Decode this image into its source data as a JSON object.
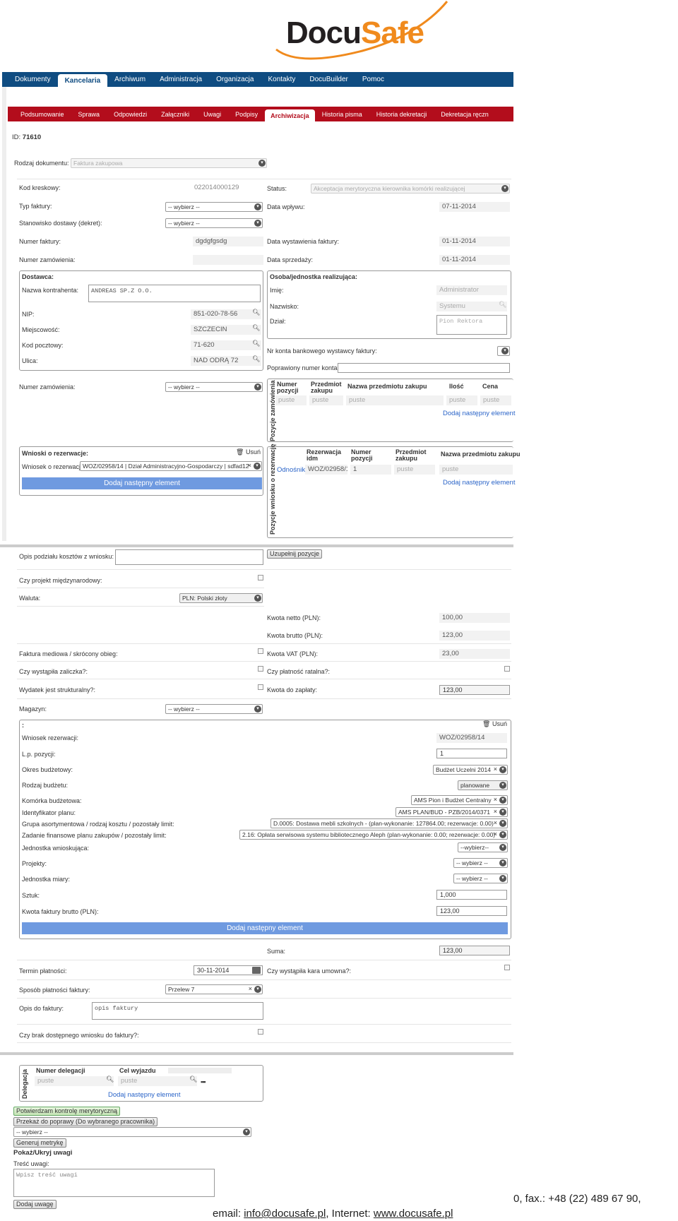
{
  "logo": {
    "part1": "Docu",
    "part2": "Safe"
  },
  "topnav": [
    "Dokumenty",
    "Kancelaria",
    "Archiwum",
    "Administracja",
    "Organizacja",
    "Kontakty",
    "DocuBuilder",
    "Pomoc"
  ],
  "subnav": [
    "Podsumowanie",
    "Sprawa",
    "Odpowiedzi",
    "Załączniki",
    "Uwagi",
    "Podpisy",
    "Archiwizacja",
    "Historia pisma",
    "Historia dekretacji",
    "Dekretacja ręczn"
  ],
  "id_label": "ID:",
  "id_value": "71610",
  "doc_type": {
    "label": "Rodzaj dokumentu:",
    "value": "Faktura zakupowa"
  },
  "left": {
    "barcode": {
      "label": "Kod kreskowy:",
      "value": "022014000129"
    },
    "invoice_type": {
      "label": "Typ faktury:",
      "value": "-- wybierz --"
    },
    "delivery_post": {
      "label": "Stanowisko dostawy (dekret):",
      "value": "-- wybierz --"
    },
    "invoice_number": {
      "label": "Numer faktury:",
      "value": "dgdgfgsdg"
    },
    "order_number": {
      "label": "Numer zamówienia:",
      "value": ""
    }
  },
  "right": {
    "status": {
      "label": "Status:",
      "value": "Akceptacja merytoryczna kierownika komórki realizującej"
    },
    "receipt_date": {
      "label": "Data wpływu:",
      "value": "07-11-2014"
    },
    "issue_date": {
      "label": "Data wystawienia faktury:",
      "value": "01-11-2014"
    },
    "sale_date": {
      "label": "Data sprzedaży:",
      "value": "01-11-2014"
    }
  },
  "supplier": {
    "title": "Dostawca:",
    "name_label": "Nazwa kontrahenta:",
    "name": "ANDREAS SP.Z O.O.",
    "nip_label": "NIP:",
    "nip": "851-020-78-56",
    "city_label": "Miejscowość:",
    "city": "SZCZECIN",
    "zip_label": "Kod pocztowy:",
    "zip": "71-620",
    "street_label": "Ulica:",
    "street": "NAD ODRĄ 72"
  },
  "person": {
    "title": "Osoba/jednostka realizująca:",
    "first_label": "Imię:",
    "first": "Administrator",
    "last_label": "Nazwisko:",
    "last": "Systemu",
    "dept_label": "Dział:",
    "dept": "Pion Rektora"
  },
  "bank": {
    "label": "Nr konta bankowego wystawcy faktury:",
    "fixed_label": "Poprawiony numer konta:"
  },
  "order_select": {
    "label": "Numer zamówienia:",
    "value": "-- wybierz --"
  },
  "order_items": {
    "vlabel": "Pozycje zamówienia",
    "cols": [
      "Numer pozycji",
      "Przedmiot zakupu",
      "Nazwa przedmiotu zakupu",
      "Ilość",
      "Cena"
    ],
    "placeholders": [
      "puste",
      "puste",
      "puste",
      "puste",
      "puste"
    ],
    "add": "Dodaj następny element"
  },
  "reservations": {
    "title": "Wnioski o rezerwacje:",
    "remove": "Usuń",
    "row_label": "Wniosek o rezerwację",
    "row_value": "WOZ/02958/14 | Dział Administracyjno-Gospodarczy | sdfad12",
    "add": "Dodaj następny element"
  },
  "res_items": {
    "vlabel": "Pozycje wniosku o rezerwację",
    "cols": [
      "Rezerwacja idm",
      "Numer pozycji",
      "Przedmiot zakupu",
      "Nazwa przedmiotu zakupu"
    ],
    "link": "Odnośnik",
    "idm": "WOZ/02958/1",
    "pos": "1",
    "ph1": "puste",
    "ph2": "puste",
    "add": "Dodaj następny element"
  },
  "cost_desc": {
    "label": "Opis podziału kosztów z wniosku:",
    "button": "Uzupełnij pozycje"
  },
  "intl": {
    "label": "Czy projekt międzynarodowy:"
  },
  "currency": {
    "label": "Waluta:",
    "value": "PLN: Polski złoty"
  },
  "amounts": {
    "net_label": "Kwota netto (PLN):",
    "net": "100,00",
    "gross_label": "Kwota brutto (PLN):",
    "gross": "123,00",
    "vat_label": "Kwota VAT (PLN):",
    "vat": "23,00",
    "installment_label": "Czy płatność ratalna?:",
    "pay_label": "Kwota do zapłaty:",
    "pay": "123,00"
  },
  "flags": {
    "media": "Faktura mediowa / skrócony obieg:",
    "advance": "Czy wystąpiła zaliczka?:",
    "structural": "Wydatek jest strukturalny?:"
  },
  "warehouse": {
    "label": "Magazyn:",
    "value": "-- wybierz --"
  },
  "budget": {
    "colon": ":",
    "remove": "Usuń",
    "res_label": "Wniosek rezerwacji:",
    "res": "WOZ/02958/14",
    "lp_label": "L.p. pozycji:",
    "lp": "1",
    "period_label": "Okres budżetowy:",
    "period": "Budżet Uczelni 2014",
    "type_label": "Rodzaj budżetu:",
    "type": "planowane",
    "cell_label": "Komórka budżetowa:",
    "cell": "AMS Pion i Budżet Centralny",
    "plan_label": "Identyfikator planu:",
    "plan": "AMS PLAN/BUD - PZB/2014/0371",
    "group_label": "Grupa asortymentowa / rodzaj kosztu / pozostały limit:",
    "group": "D.0005: Dostawa mebli szkolnych - (plan-wykonanie: 127864.00; rezerwacje: 0.00)",
    "task_label": "Zadanie finansowe planu zakupów / pozostały limit:",
    "task": "2.16: Opłata serwisowa systemu bibliotecznego Aleph (plan-wykonanie: 0.00; rezerwacje: 0.00)",
    "unit_label": "Jednostka wnioskująca:",
    "unit": "--wybierz--",
    "projects_label": "Projekty:",
    "projects": "-- wybierz --",
    "measure_label": "Jednostka miary:",
    "measure": "-- wybierz --",
    "pcs_label": "Sztuk:",
    "pcs": "1,000",
    "gross_label": "Kwota faktury brutto (PLN):",
    "gross": "123,00",
    "add": "Dodaj następny element"
  },
  "sum": {
    "label": "Suma:",
    "value": "123,00"
  },
  "due": {
    "label": "Termin płatności:",
    "value": "30-11-2014",
    "penalty": "Czy wystąpiła kara umowna?:"
  },
  "payment": {
    "label": "Sposób płatności faktury:",
    "value": "Przelew 7"
  },
  "desc": {
    "label": "Opis do faktury:",
    "value": "opis faktury"
  },
  "nores": {
    "label": "Czy brak dostępnego wniosku do faktury?:"
  },
  "deleg": {
    "vlabel": "Delegacja",
    "col1": "Numer delegacji",
    "col2": "Cel wyjazdu",
    "ph1": "puste",
    "ph2": "puste",
    "add": "Dodaj następny element"
  },
  "actions": {
    "confirm": "Potwierdzam kontrolę merytoryczną",
    "return": "Przekaż do poprawy (Do wybranego pracownika)",
    "select": "-- wybierz --",
    "metric": "Generuj metrykę",
    "toggle": "Pokaż/Ukryj uwagi",
    "note_label": "Treść uwagi:",
    "note_ph": "Wpisz treść uwagi",
    "add_note": "Dodaj uwagę"
  },
  "footer": {
    "line1": "0, fax.: +48 (22) 489 67 90,",
    "email_label": "email: ",
    "email": "info@docusafe.pl",
    "sep": ", Internet: ",
    "web": "www.docusafe.pl"
  }
}
